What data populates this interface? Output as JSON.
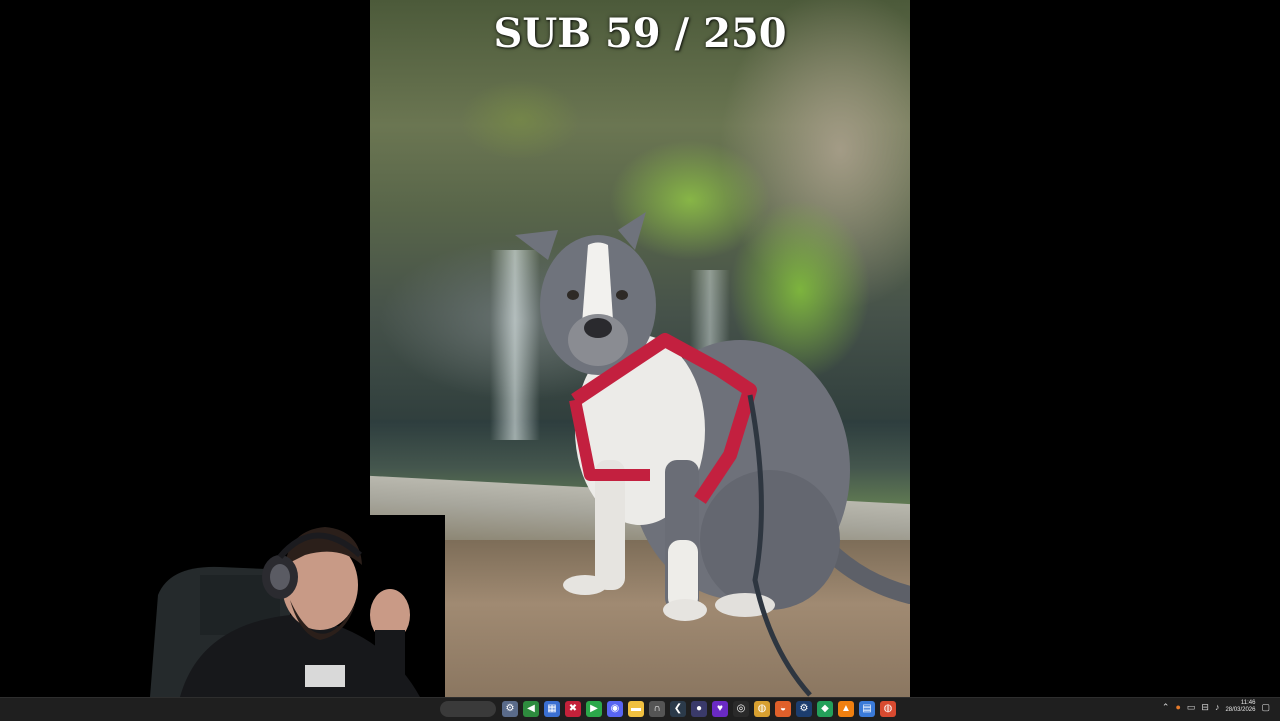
{
  "overlay": {
    "sub_counter": "SUB 59 / 250"
  },
  "photo": {
    "subject": "dog-in-red-harness"
  },
  "taskbar": {
    "icons": [
      {
        "name": "settings-icon",
        "glyph": "⚙",
        "color": "#5a6b8a"
      },
      {
        "name": "app-green-icon",
        "glyph": "◀",
        "color": "#2e8b3e"
      },
      {
        "name": "calendar-icon",
        "glyph": "▦",
        "color": "#3b6fd1"
      },
      {
        "name": "red-app-icon",
        "glyph": "✖",
        "color": "#c4213a"
      },
      {
        "name": "play-icon",
        "glyph": "▶",
        "color": "#2ca84a"
      },
      {
        "name": "discord-icon",
        "glyph": "◉",
        "color": "#5865f2"
      },
      {
        "name": "folder-icon",
        "glyph": "▬",
        "color": "#f0c040"
      },
      {
        "name": "headset-icon",
        "glyph": "∩",
        "color": "#555555"
      },
      {
        "name": "steam-icon",
        "glyph": "❮",
        "color": "#2b3a4a"
      },
      {
        "name": "video-icon",
        "glyph": "●",
        "color": "#3a3a6a"
      },
      {
        "name": "heart-icon",
        "glyph": "♥",
        "color": "#6a2ac4"
      },
      {
        "name": "obs-icon",
        "glyph": "◎",
        "color": "#2a2a2a"
      },
      {
        "name": "chrome-icon",
        "glyph": "◍",
        "color": "#d8a030"
      },
      {
        "name": "firefox-icon",
        "glyph": "◒",
        "color": "#e0602a"
      },
      {
        "name": "steam-client-icon",
        "glyph": "⚙",
        "color": "#1c3d6e"
      },
      {
        "name": "green-app-icon",
        "glyph": "◆",
        "color": "#24a05a"
      },
      {
        "name": "vlc-icon",
        "glyph": "▲",
        "color": "#f08010"
      },
      {
        "name": "notes-icon",
        "glyph": "▤",
        "color": "#3a7ad8"
      },
      {
        "name": "chrome-active-icon",
        "glyph": "◍",
        "color": "#d84a30"
      }
    ],
    "clock_time": "11:46",
    "clock_date": "28/03/2026"
  }
}
